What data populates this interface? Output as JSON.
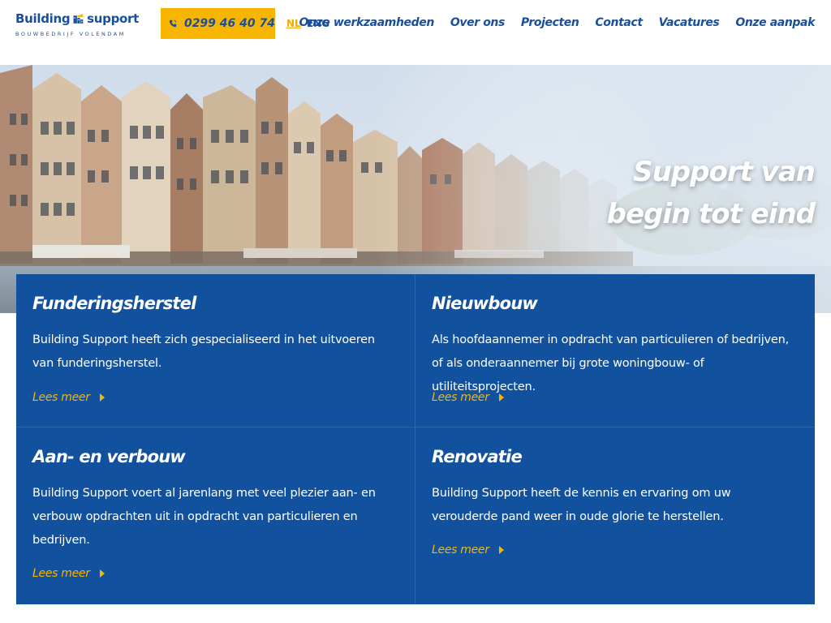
{
  "brand": {
    "name_left": "Building",
    "name_right": "support",
    "tagline": "BOUWBEDRIJF VOLENDAM",
    "colors": {
      "blue": "#1a4f9c",
      "yellow": "#f7b500",
      "card_blue": "#12519e"
    }
  },
  "header": {
    "phone": {
      "icon": "phone-icon",
      "number": "0299 46 40 74"
    },
    "languages": [
      {
        "label": "NL",
        "active": true
      },
      {
        "label": "ENG",
        "active": false
      }
    ],
    "nav": [
      {
        "label": "Onze werkzaamheden"
      },
      {
        "label": "Over ons"
      },
      {
        "label": "Projecten"
      },
      {
        "label": "Contact"
      },
      {
        "label": "Vacatures"
      },
      {
        "label": "Onze aanpak"
      }
    ]
  },
  "hero": {
    "line1": "Support van",
    "line2": "begin tot eind"
  },
  "cards": [
    {
      "title": "Funderingsherstel",
      "text": "Building Support heeft zich gespecialiseerd in het uitvoeren van funderingsherstel.",
      "link": "Lees meer"
    },
    {
      "title": "Nieuwbouw",
      "text": "Als hoofdaannemer in opdracht van particulieren of bedrijven, of als onderaannemer bij grote woningbouw- of utiliteitsprojecten.",
      "link": "Lees meer"
    },
    {
      "title": "Aan- en verbouw",
      "text": "Building Support voert al jarenlang met veel plezier aan- en verbouw opdrachten uit in opdracht van particulieren en bedrijven.",
      "link": "Lees meer"
    },
    {
      "title": "Renovatie",
      "text": "Building Support heeft de kennis en ervaring om uw verouderde pand weer in oude glorie te herstellen.",
      "link": "Lees meer"
    }
  ]
}
